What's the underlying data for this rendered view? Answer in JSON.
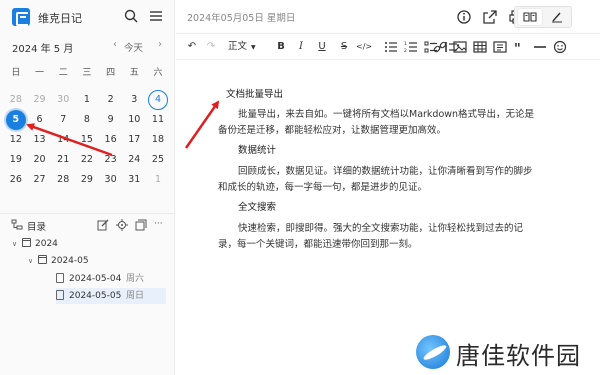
{
  "app": {
    "title": "维克日记"
  },
  "calendar": {
    "month_label": "2024 年 5 月",
    "today_label": "今天",
    "weekdays": [
      "日",
      "一",
      "二",
      "三",
      "四",
      "五",
      "六"
    ],
    "weeks": [
      [
        "28",
        "29",
        "30",
        "1",
        "2",
        "3",
        "4"
      ],
      [
        "5",
        "6",
        "7",
        "8",
        "9",
        "10",
        "11"
      ],
      [
        "12",
        "13",
        "14",
        "15",
        "16",
        "17",
        "18"
      ],
      [
        "19",
        "20",
        "21",
        "22",
        "23",
        "24",
        "25"
      ],
      [
        "26",
        "27",
        "28",
        "29",
        "30",
        "31",
        "1"
      ]
    ],
    "selected": "5",
    "today": "4"
  },
  "toc": {
    "title": "目录"
  },
  "tree": {
    "year": "2024",
    "month": "2024-05",
    "entries": [
      {
        "date": "2024-05-04",
        "weekday": "周六"
      },
      {
        "date": "2024-05-05",
        "weekday": "周日"
      }
    ]
  },
  "header": {
    "date_title": "2024年05月05日 星期日"
  },
  "toolbar": {
    "paragraph_label": "正文",
    "bold": "B",
    "italic": "I",
    "underline": "U",
    "strike": "S",
    "code": "</>"
  },
  "document": {
    "heading": "文档批量导出",
    "para1_line1": "批量导出，来去自如。一键将所有文档以Markdown格式导出，无论是",
    "para1_line2": "备份还是迁移，都能轻松应对，让数据管理更加高效。",
    "heading2": "数据统计",
    "para2_line1": "回顾成长，数据见证。详细的数据统计功能，让你清晰看到写作的脚步",
    "para2_line2": "和成长的轨迹，每一字每一句，都是进步的见证。",
    "heading3": "全文搜索",
    "para3_line1": "快速检索，即搜即得。强大的全文搜索功能，让你轻松找到过去的记",
    "para3_line2": "录，每一个关键词，都能迅速带你回到那一刻。"
  },
  "watermark": {
    "text": "唐佳软件园"
  },
  "colors": {
    "accent": "#1a7fe0",
    "arrow": "#e02020"
  }
}
